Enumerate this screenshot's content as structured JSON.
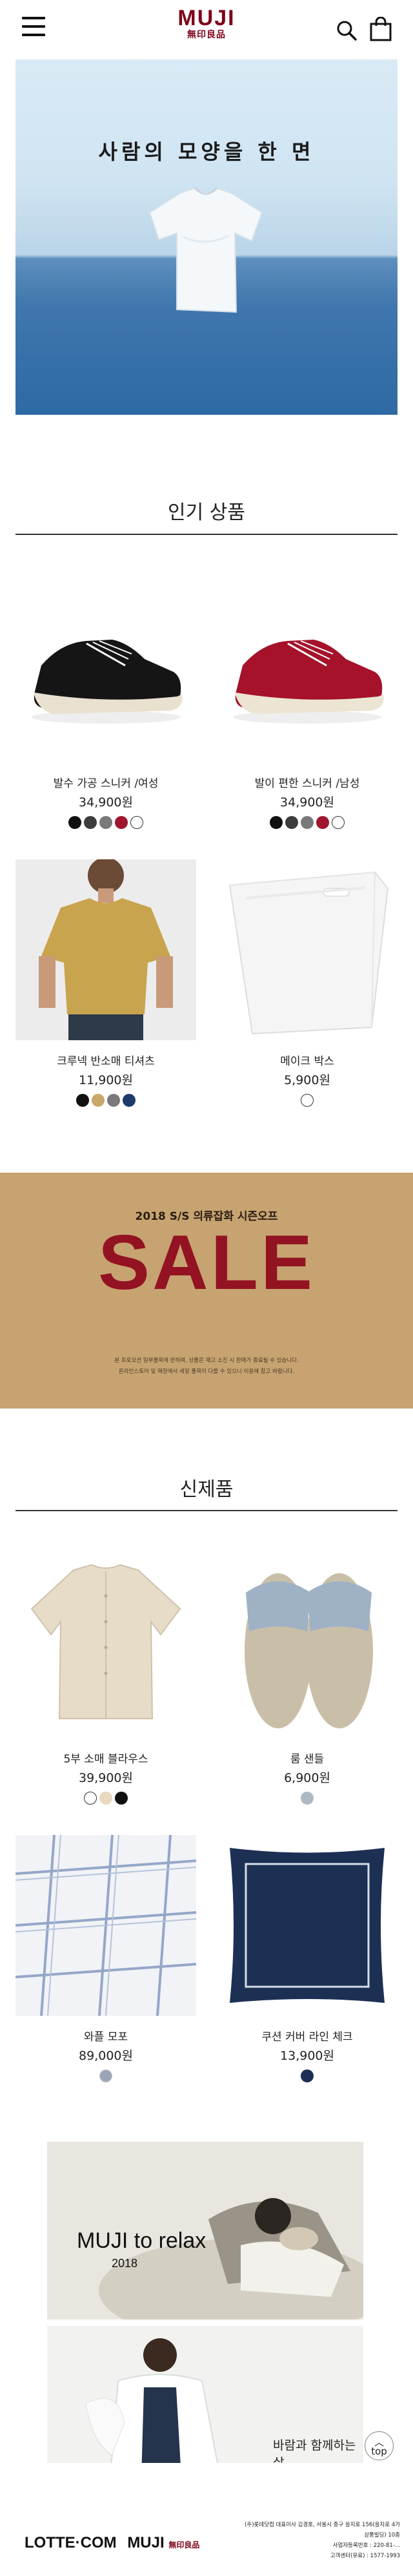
{
  "header": {
    "logo_en": "MUJI",
    "logo_ko": "無印良品",
    "brand_color": "#7f0019",
    "icons": [
      "menu-icon",
      "search-icon",
      "shopping-bag-icon"
    ]
  },
  "hero": {
    "title": "사람의 모양을 한 면"
  },
  "popular": {
    "title": "인기 상품",
    "items": [
      {
        "name": "발수 가공 스니커 /여성",
        "price": "34,900원",
        "swatches": [
          "#111111",
          "#3d3d3d",
          "#7a7a7a",
          "#a0162e",
          "#ffffff"
        ]
      },
      {
        "name": "발이 편한 스니커 /남성",
        "price": "34,900원",
        "swatches": [
          "#111111",
          "#3d3d3d",
          "#7a7a7a",
          "#a0162e",
          "#ffffff"
        ]
      },
      {
        "name": "크루넥 반소매 티셔츠",
        "price": "11,900원",
        "swatches": [
          "#111111",
          "#c8a86b",
          "#7a7a7a",
          "#1f3a6b"
        ]
      },
      {
        "name": "메이크 박스",
        "price": "5,900원",
        "swatches": [
          "#ffffff"
        ]
      }
    ]
  },
  "sale": {
    "subtitle": "2018 S/S 의류잡화 시즌오프",
    "headline": "SALE",
    "note_line1": "본 프로모션 일부품목에 한하며, 상품은 재고 소진 시 판매가 종료될 수 있습니다.",
    "note_line2": "온라인스토어 및 매장에서 세일 품목이 다를 수 있으니 이용에 참고 바랍니다."
  },
  "new_items": {
    "title": "신제품",
    "items": [
      {
        "name": "5부 소매 블라우스",
        "price": "39,900원",
        "swatches": [
          "#ffffff",
          "#e8d9bf",
          "#111111"
        ]
      },
      {
        "name": "룸 샌들",
        "price": "6,900원",
        "swatches": [
          "#aeb9c6"
        ]
      },
      {
        "name": "와플 모포",
        "price": "89,000원",
        "swatches": [
          "#9aa5b8"
        ]
      },
      {
        "name": "쿠션 커버 라인 체크",
        "price": "13,900원",
        "swatches": [
          "#1c3054"
        ]
      }
    ]
  },
  "banners": {
    "relax_title": "MUJI to relax",
    "relax_year": "2018",
    "wind_text": "바람과 함께하는 삶"
  },
  "top_button": "top",
  "footer": {
    "lotte": "LOTTE·COM",
    "muji": "MUJI",
    "muji_ko": "無印良品",
    "company_line1": "(주)롯데닷컴 대표이사 김경호, 서울시 중구 을지로 156(을지로 4가 삼풍빌딩) 10층",
    "company_line2": "사업자등록번호 : 220-81-...",
    "cs_line": "고객센터(유료) : 1577-1993"
  }
}
